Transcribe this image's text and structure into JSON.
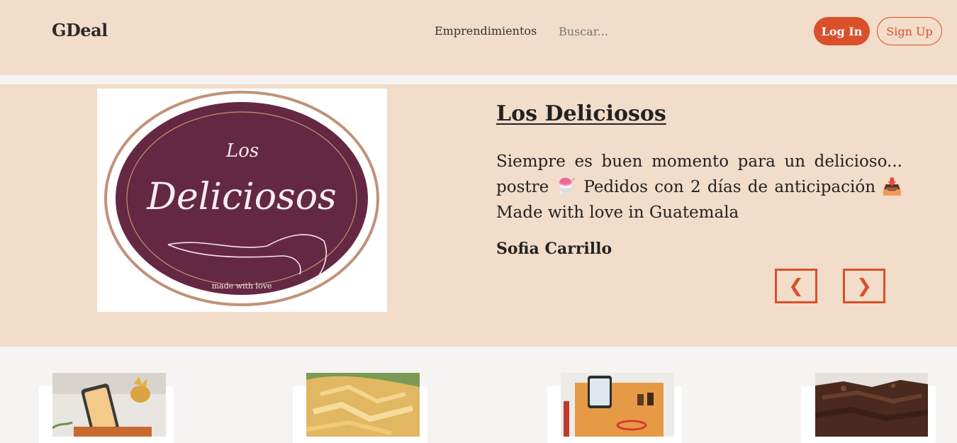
{
  "header": {
    "brand": "GDeal",
    "nav_link": "Emprendimientos",
    "search_placeholder": "Buscar...",
    "login_label": "Log In",
    "signup_label": "Sign Up"
  },
  "featured": {
    "title": "Los Deliciosos",
    "description": "Siempre es buen momento para un delicioso... postre 🍧 Pedidos con 2 días de anticipación 📥 Made with love in Guatemala",
    "owner": "Sofia Carrillo",
    "logo": {
      "text_small": "Los",
      "text_main": "Deliciosos",
      "tagline": "made with love"
    },
    "prev_glyph": "❮",
    "next_glyph": "❯"
  },
  "colors": {
    "accent": "#d9502b",
    "banner": "#f2dcca",
    "logo_fill": "#652842",
    "logo_ring": "#c19277"
  },
  "products": [
    {
      "name": "phone-stand"
    },
    {
      "name": "pastry"
    },
    {
      "name": "desk-organizer"
    },
    {
      "name": "brownies"
    }
  ]
}
